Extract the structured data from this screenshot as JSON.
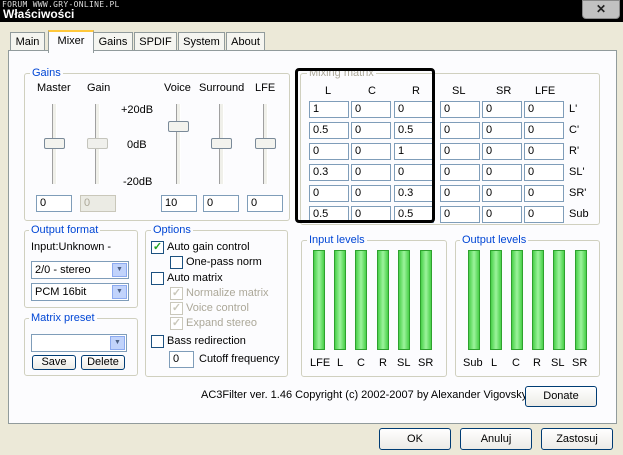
{
  "window": {
    "watermark": "FORUM WWW.GRY-ONLINE.PL",
    "title": "Właściwości",
    "close_glyph": "✕"
  },
  "tabs": [
    "Main",
    "Mixer",
    "Gains",
    "SPDIF",
    "System",
    "About"
  ],
  "gains": {
    "title": "Gains",
    "labels": [
      "Master",
      "Gain",
      "Voice",
      "Surround",
      "LFE"
    ],
    "scale": [
      "+20dB",
      "0dB",
      "-20dB"
    ],
    "values": [
      "0",
      "0",
      "10",
      "0",
      "0"
    ]
  },
  "matrix": {
    "title": "Mixing matrix",
    "col_headers": [
      "L",
      "C",
      "R",
      "SL",
      "SR",
      "LFE"
    ],
    "row_labels": [
      "L'",
      "C'",
      "R'",
      "SL'",
      "SR'",
      "Sub"
    ],
    "rows": [
      [
        "1",
        "0",
        "0",
        "0",
        "0",
        "0"
      ],
      [
        "0.5",
        "0",
        "0.5",
        "0",
        "0",
        "0"
      ],
      [
        "0",
        "0",
        "1",
        "0",
        "0",
        "0"
      ],
      [
        "0.3",
        "0",
        "0",
        "0",
        "0",
        "0"
      ],
      [
        "0",
        "0",
        "0.3",
        "0",
        "0",
        "0"
      ],
      [
        "0.5",
        "0",
        "0.5",
        "0",
        "0",
        "0"
      ]
    ]
  },
  "output_format": {
    "title": "Output format",
    "input_label": "Input:Unknown -",
    "channels": "2/0 - stereo",
    "sample": "PCM 16bit"
  },
  "options": {
    "title": "Options",
    "auto_gain": "Auto gain control",
    "one_pass": "One-pass norm",
    "auto_matrix": "Auto matrix",
    "normalize": "Normalize matrix",
    "voice_control": "Voice control",
    "expand_stereo": "Expand stereo",
    "bass_redirection": "Bass redirection",
    "cutoff_value": "0",
    "cutoff_label": "Cutoff frequency",
    "check": "✓"
  },
  "matrix_preset": {
    "title": "Matrix preset",
    "value": "",
    "save": "Save",
    "delete": "Delete"
  },
  "input_levels": {
    "title": "Input levels",
    "labels": [
      "LFE",
      "L",
      "C",
      "R",
      "SL",
      "SR"
    ]
  },
  "output_levels": {
    "title": "Output levels",
    "labels": [
      "Sub",
      "L",
      "C",
      "R",
      "SL",
      "SR"
    ]
  },
  "footer": {
    "copyright": "AC3Filter ver. 1.46 Copyright (c) 2002-2007 by Alexander Vigovsky",
    "donate": "Donate"
  },
  "buttons": {
    "ok": "OK",
    "cancel": "Anuluj",
    "apply": "Zastosuj"
  },
  "arrow_glyph": "▼"
}
